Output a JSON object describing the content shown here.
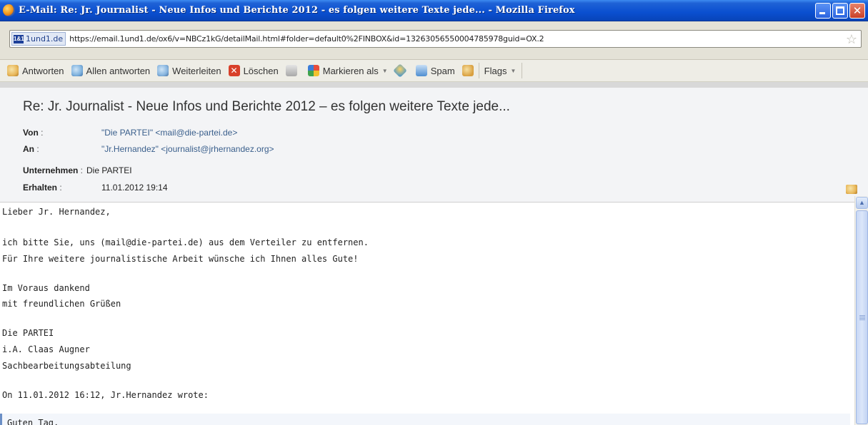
{
  "window": {
    "title": "E-Mail: Re: Jr. Journalist - Neue Infos und Berichte 2012 - es folgen weitere Texte jede... - Mozilla Firefox"
  },
  "urlbar": {
    "site_name": "1und1.de",
    "site_icon_text": "1&1",
    "url": "https://email.1und1.de/ox6/v=NBCz1kG/detailMail.html#folder=default0%2FINBOX&id=13263056550004785978guid=OX.2"
  },
  "toolbar": {
    "reply": "Antworten",
    "reply_all": "Allen antworten",
    "forward": "Weiterleiten",
    "delete": "Löschen",
    "mark_as": "Markieren als",
    "spam": "Spam",
    "flags": "Flags"
  },
  "message": {
    "subject": "Re: Jr. Journalist - Neue Infos und Berichte 2012 – es folgen weitere Texte jede...",
    "from_label": "Von",
    "from_value": "\"Die PARTEI\" <mail@die-partei.de>",
    "to_label": "An",
    "to_value": "\"Jr.Hernandez\" <journalist@jrhernandez.org>",
    "company_label": "Unternehmen",
    "company_value": "Die PARTEI",
    "received_label": "Erhalten",
    "received_value": "11.01.2012 19:14",
    "body_lines": [
      "Lieber Jr. Hernandez,",
      "ich bitte Sie, uns (mail@die-partei.de) aus dem Verteiler zu entfernen.",
      "Für Ihre weitere journalistische Arbeit wünsche ich Ihnen alles Gute!",
      "Im Voraus dankend",
      "mit freundlichen Grüßen",
      "Die PARTEI",
      "i.A. Claas Augner",
      "Sachbearbeitungsabteilung",
      "On 11.01.2012 16:12, Jr.Hernandez wrote:"
    ],
    "quoted_line": "Guten Tag,"
  }
}
